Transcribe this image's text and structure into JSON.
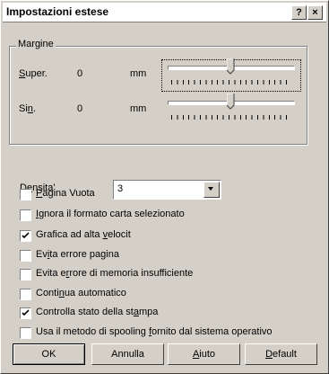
{
  "window": {
    "title": "Impostazioni estese",
    "help_label": "?",
    "close_label": "×"
  },
  "margins": {
    "group_label": "Margine",
    "top": {
      "label_pre": "",
      "label_ul": "S",
      "label_post": "uper.",
      "value": "0",
      "unit": "mm",
      "level": 0.5
    },
    "left": {
      "label_pre": "Si",
      "label_ul": "n",
      "label_post": ".",
      "value": "0",
      "unit": "mm",
      "level": 0.5
    }
  },
  "density": {
    "label_pre": "D",
    "label_ul": "e",
    "label_post": "nsita'",
    "value": "3"
  },
  "options": [
    {
      "pre": "",
      "ul": "P",
      "post": "agina Vuota",
      "checked": false
    },
    {
      "pre": "",
      "ul": "I",
      "post": "gnora il formato carta selezionato",
      "checked": false
    },
    {
      "pre": "Grafica ad alta ",
      "ul": "v",
      "post": "elocit",
      "checked": true
    },
    {
      "pre": "Ev",
      "ul": "i",
      "post": "ta errore pagina",
      "checked": false
    },
    {
      "pre": "Evita e",
      "ul": "r",
      "post": "rore di memoria insufficiente",
      "checked": false
    },
    {
      "pre": "Conti",
      "ul": "n",
      "post": "ua automatico",
      "checked": false
    },
    {
      "pre": "Controlla stato della st",
      "ul": "a",
      "post": "mpa",
      "checked": true
    },
    {
      "pre": "Usa il metodo di spooling ",
      "ul": "f",
      "post": "ornito dal sistema operativo",
      "checked": false
    }
  ],
  "buttons": {
    "ok": "OK",
    "cancel": "Annulla",
    "help_pre": "",
    "help_ul": "A",
    "help_post": "iuto",
    "default_pre": "",
    "default_ul": "D",
    "default_post": "efault"
  }
}
